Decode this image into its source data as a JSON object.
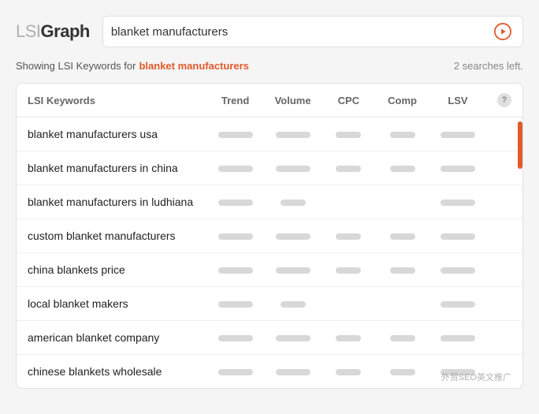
{
  "header": {
    "logo_lsi": "LSI",
    "logo_graph": "Graph",
    "search_value": "blanket manufacturers",
    "search_placeholder": "blanket manufacturers"
  },
  "subtitle": {
    "showing": "Showing LSI Keywords for",
    "keyword": "blanket manufacturers",
    "searches_left": "2 searches left."
  },
  "table": {
    "columns": [
      {
        "key": "keyword",
        "label": "LSI Keywords"
      },
      {
        "key": "trend",
        "label": "Trend"
      },
      {
        "key": "volume",
        "label": "Volume"
      },
      {
        "key": "cpc",
        "label": "CPC"
      },
      {
        "key": "comp",
        "label": "Comp"
      },
      {
        "key": "lsv",
        "label": "LSV"
      }
    ],
    "rows": [
      {
        "keyword": "blanket manufacturers usa",
        "trend": "md",
        "volume": "md",
        "cpc": "sm",
        "comp": "sm",
        "lsv": "md"
      },
      {
        "keyword": "blanket manufacturers in china",
        "trend": "md",
        "volume": "md",
        "cpc": "sm",
        "comp": "sm",
        "lsv": "md"
      },
      {
        "keyword": "blanket manufacturers in ludhiana",
        "trend": "md",
        "volume": "sm",
        "cpc": "",
        "comp": "",
        "lsv": "md"
      },
      {
        "keyword": "custom blanket manufacturers",
        "trend": "md",
        "volume": "md",
        "cpc": "sm",
        "comp": "sm",
        "lsv": "md"
      },
      {
        "keyword": "china blankets price",
        "trend": "md",
        "volume": "md",
        "cpc": "sm",
        "comp": "sm",
        "lsv": "md"
      },
      {
        "keyword": "local blanket makers",
        "trend": "md",
        "volume": "sm",
        "cpc": "",
        "comp": "",
        "lsv": "md"
      },
      {
        "keyword": "american blanket company",
        "trend": "md",
        "volume": "md",
        "cpc": "sm",
        "comp": "sm",
        "lsv": "md"
      },
      {
        "keyword": "chinese blankets wholesale",
        "trend": "md",
        "volume": "md",
        "cpc": "sm",
        "comp": "sm",
        "lsv": "md"
      }
    ]
  },
  "watermark": "外贸SEO英文推广",
  "colors": {
    "accent": "#e05a2b",
    "logo_light": "#b0b0b0",
    "bar": "#d8d8d8",
    "info_bg": "#e0e0e0"
  }
}
